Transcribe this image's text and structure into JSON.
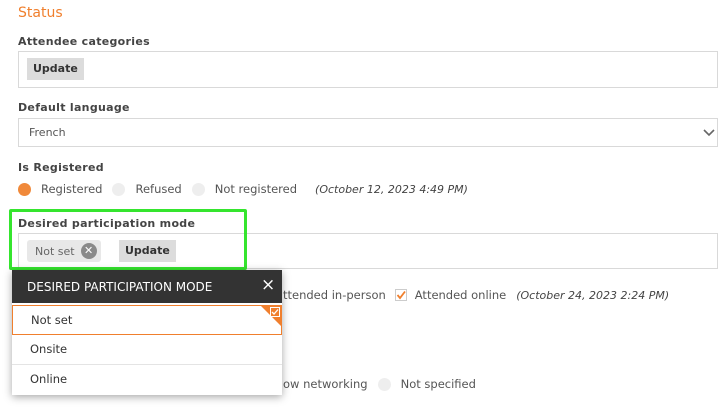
{
  "status": {
    "title": "Status"
  },
  "attendee_categories": {
    "label": "Attendee categories",
    "update_label": "Update"
  },
  "default_language": {
    "label": "Default language",
    "selected": "French"
  },
  "is_registered": {
    "label": "Is Registered",
    "options": [
      "Registered",
      "Refused",
      "Not registered"
    ],
    "selected_index": 0,
    "timestamp": "(October 12, 2023 4:49 PM)"
  },
  "participation_mode": {
    "label": "Desired participation mode",
    "chip_value": "Not set",
    "update_label": "Update"
  },
  "attendance": {
    "in_person_label": "ttended in-person",
    "online_label": "Attended online",
    "timestamp": "(October 24, 2023 2:24 PM)"
  },
  "networking": {
    "option_1": "ow networking",
    "option_2": "Not specified"
  },
  "dropdown": {
    "title": "DESIRED PARTICIPATION MODE",
    "close_glyph": "×",
    "items": [
      "Not set",
      "Onsite",
      "Online"
    ],
    "selected_index": 0
  },
  "colors": {
    "accent": "#f07f2d",
    "highlight": "#35e52e",
    "dropdown_header": "#333333"
  }
}
